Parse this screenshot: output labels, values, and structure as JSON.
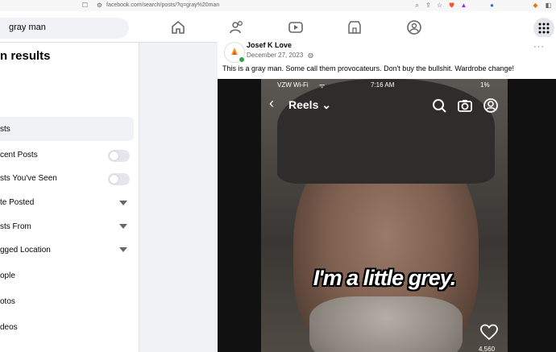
{
  "browser": {
    "url": "facebook.com/search/posts/?q=gray%20man"
  },
  "search": {
    "query": "gray man"
  },
  "sidebar": {
    "title": "n results",
    "items": [
      {
        "label": "sts"
      },
      {
        "label": "cent Posts"
      },
      {
        "label": "sts You've Seen"
      },
      {
        "label": "te Posted"
      },
      {
        "label": "sts From"
      },
      {
        "label": "gged Location"
      },
      {
        "label": "ople"
      },
      {
        "label": "otos"
      },
      {
        "label": "deos"
      }
    ]
  },
  "post": {
    "author": "Josef K Love",
    "date": "December 27, 2023",
    "text": "This is a gray man.  Some call them provocateurs.  Don't buy the bullshit.  Wardrobe change!",
    "more": "···"
  },
  "video": {
    "carrier": "VZW Wi-Fi",
    "time": "7:16 AM",
    "battery": "1%",
    "reels_label": "Reels",
    "caption": "I'm a little grey.",
    "like_count": "4,560"
  }
}
